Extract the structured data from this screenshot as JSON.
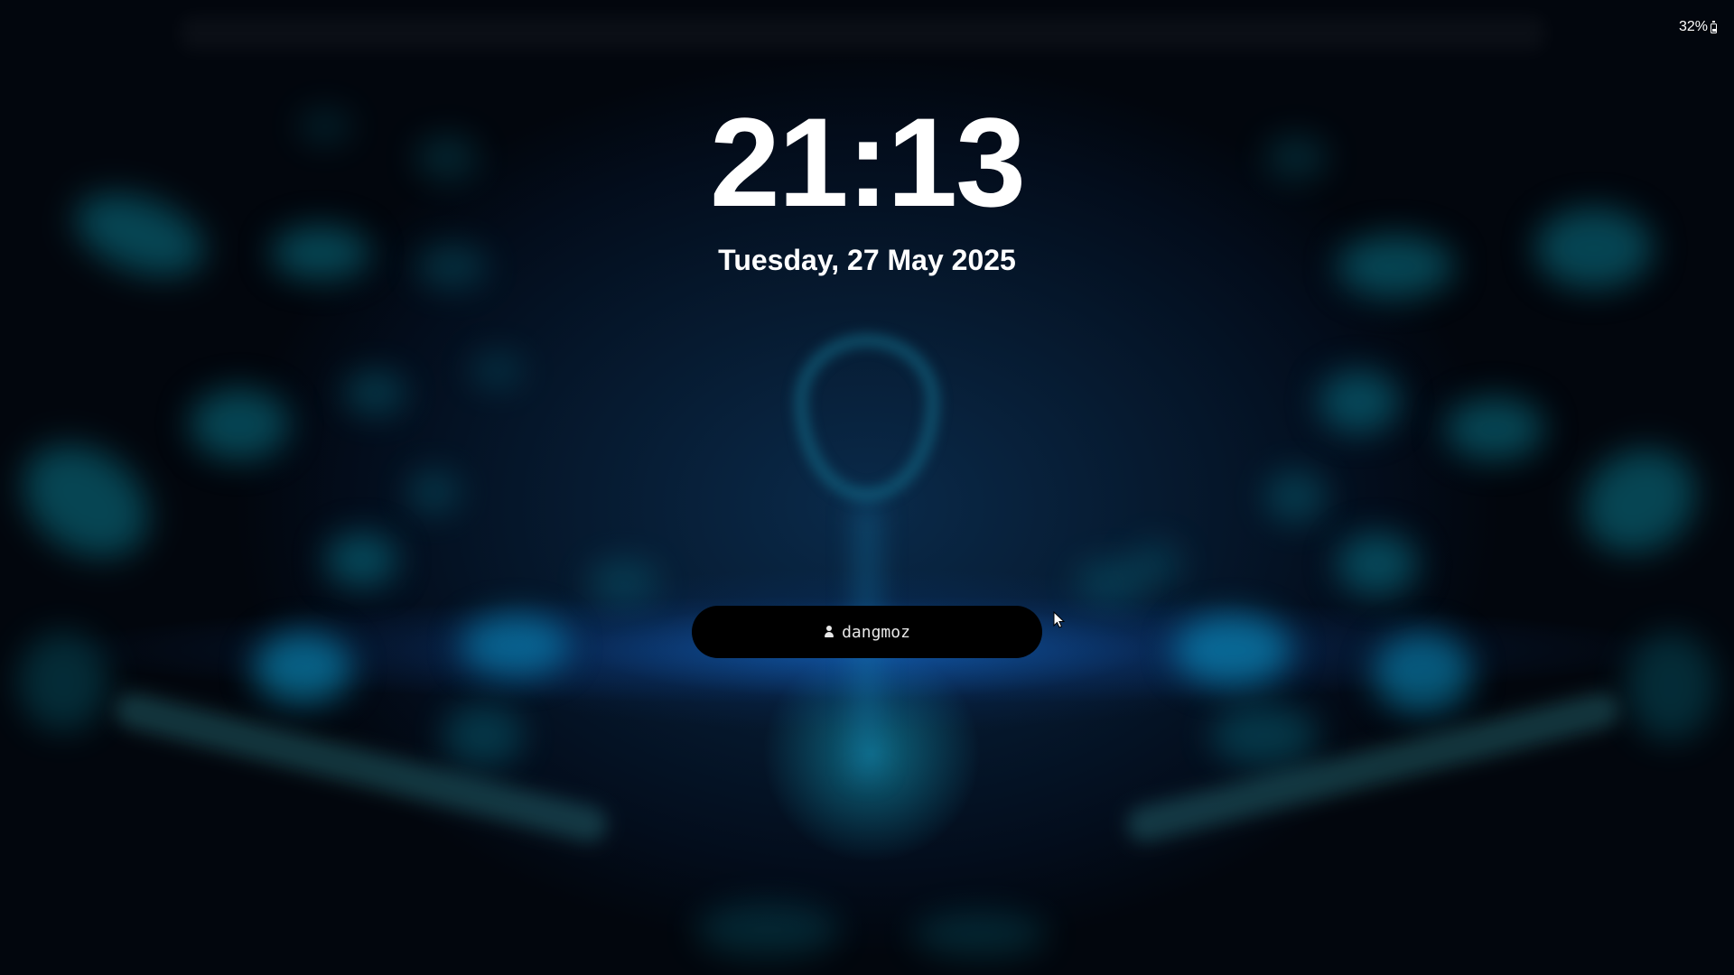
{
  "status_bar": {
    "battery_percent": "32%",
    "battery_level": 0.32
  },
  "lock_screen": {
    "time": "21:13",
    "date": "Tuesday, 27 May 2025"
  },
  "user": {
    "name": "dangmoz",
    "icon": "user-icon"
  },
  "colors": {
    "background": "#030b18",
    "accent_glow": "#1478d2",
    "pill": "#000000",
    "text": "#ffffff"
  }
}
